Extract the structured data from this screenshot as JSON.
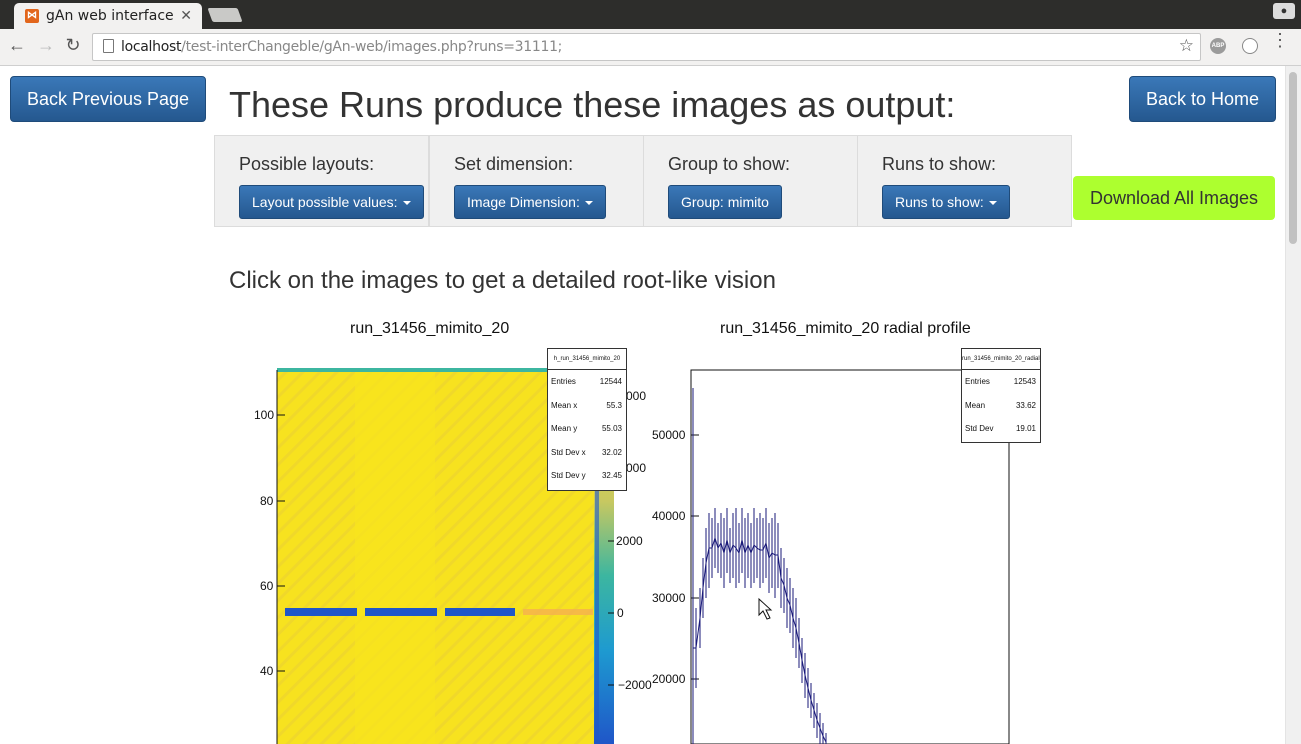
{
  "browser": {
    "tab_title": "gAn web interface",
    "url_host": "localhost",
    "url_path": "/test-interChangeble/gAn-web/images.php?runs=31111;",
    "ext_label": "ABP"
  },
  "page": {
    "back_previous": "Back Previous Page",
    "back_home": "Back to Home",
    "headline": "These Runs produce these images as output:",
    "download_all": "Download All Images",
    "hint": "Click on the images to get a detailed root-like vision",
    "panels": [
      {
        "title": "Possible layouts:",
        "button": "Layout possible values:",
        "dropdown": true
      },
      {
        "title": "Set dimension:",
        "button": "Image Dimension:",
        "dropdown": true
      },
      {
        "title": "Group to show:",
        "button": "Group: mimito",
        "dropdown": false
      },
      {
        "title": "Runs to show:",
        "button": "Runs to show:",
        "dropdown": true
      }
    ]
  },
  "plots": [
    {
      "title": "run_31456_mimito_20",
      "stat_header": "h_run_31456_mimito_20",
      "stats": [
        {
          "key": "Entries",
          "value": "12544"
        },
        {
          "key": "Mean x",
          "value": "55.3"
        },
        {
          "key": "Mean y",
          "value": "55.03"
        },
        {
          "key": "Std Dev x",
          "value": "32.02"
        },
        {
          "key": "Std Dev y",
          "value": "32.45"
        }
      ],
      "y_ticks": [
        "100",
        "80",
        "60",
        "40"
      ],
      "z_ticks": [
        "000",
        "000",
        "2000",
        "0",
        "−2000"
      ]
    },
    {
      "title": "run_31456_mimito_20 radial profile",
      "stat_header": "run_31456_mimito_20_radial_profile",
      "stats": [
        {
          "key": "Entries",
          "value": "12543"
        },
        {
          "key": "Mean",
          "value": "33.62"
        },
        {
          "key": "Std Dev",
          "value": "19.01"
        }
      ],
      "y_ticks": [
        "50000",
        "40000",
        "30000",
        "20000"
      ]
    }
  ],
  "colors": {
    "primary": "#2a6297",
    "download": "#adff2f",
    "heatmap_bg": "#f7e21f",
    "heatmap_line": "#1f56c8",
    "profile_line": "#1a1a7a"
  }
}
